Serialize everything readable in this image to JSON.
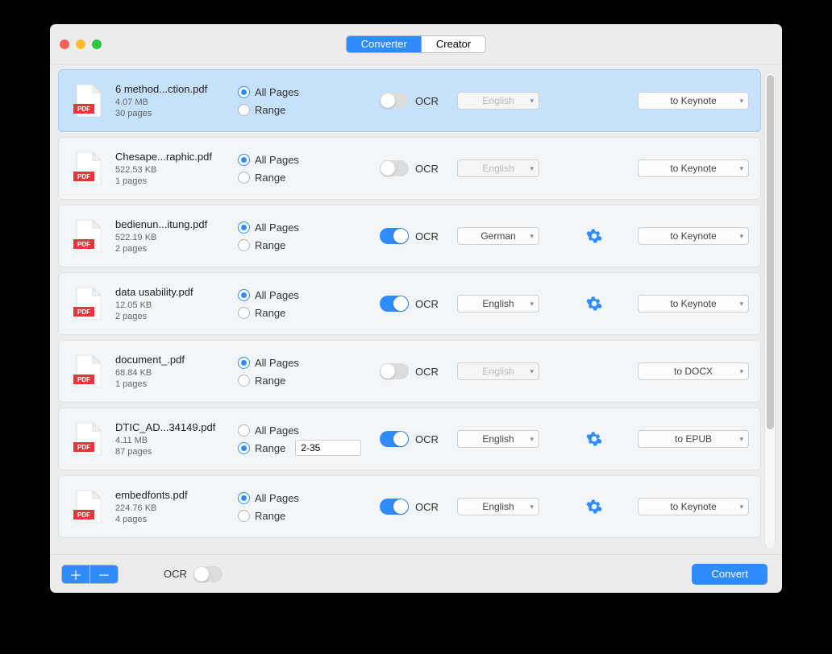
{
  "tabs": {
    "converter": "Converter",
    "creator": "Creator"
  },
  "labels": {
    "allPages": "All Pages",
    "range": "Range",
    "ocr": "OCR",
    "convert": "Convert"
  },
  "footer": {
    "ocrLabel": "OCR",
    "ocrOn": false
  },
  "files": [
    {
      "name": "6 method...ction.pdf",
      "size": "4.07 MB",
      "pages": "30 pages",
      "selected": true,
      "pageMode": "all",
      "rangeText": "",
      "ocrOn": false,
      "lang": "English",
      "format": "to Keynote"
    },
    {
      "name": "Chesape...raphic.pdf",
      "size": "522.53 KB",
      "pages": "1 pages",
      "selected": false,
      "pageMode": "all",
      "rangeText": "",
      "ocrOn": false,
      "lang": "English",
      "format": "to Keynote"
    },
    {
      "name": "bedienun...itung.pdf",
      "size": "522.19 KB",
      "pages": "2 pages",
      "selected": false,
      "pageMode": "all",
      "rangeText": "",
      "ocrOn": true,
      "lang": "German",
      "format": "to Keynote"
    },
    {
      "name": "data usability.pdf",
      "size": "12.05 KB",
      "pages": "2 pages",
      "selected": false,
      "pageMode": "all",
      "rangeText": "",
      "ocrOn": true,
      "lang": "English",
      "format": "to Keynote"
    },
    {
      "name": "document_.pdf",
      "size": "68.84 KB",
      "pages": "1 pages",
      "selected": false,
      "pageMode": "all",
      "rangeText": "",
      "ocrOn": false,
      "lang": "English",
      "format": "to DOCX"
    },
    {
      "name": "DTIC_AD...34149.pdf",
      "size": "4.11 MB",
      "pages": "87 pages",
      "selected": false,
      "pageMode": "range",
      "rangeText": "2-35",
      "ocrOn": true,
      "lang": "English",
      "format": "to EPUB"
    },
    {
      "name": "embedfonts.pdf",
      "size": "224.76 KB",
      "pages": "4 pages",
      "selected": false,
      "pageMode": "all",
      "rangeText": "",
      "ocrOn": true,
      "lang": "English",
      "format": "to Keynote"
    }
  ]
}
